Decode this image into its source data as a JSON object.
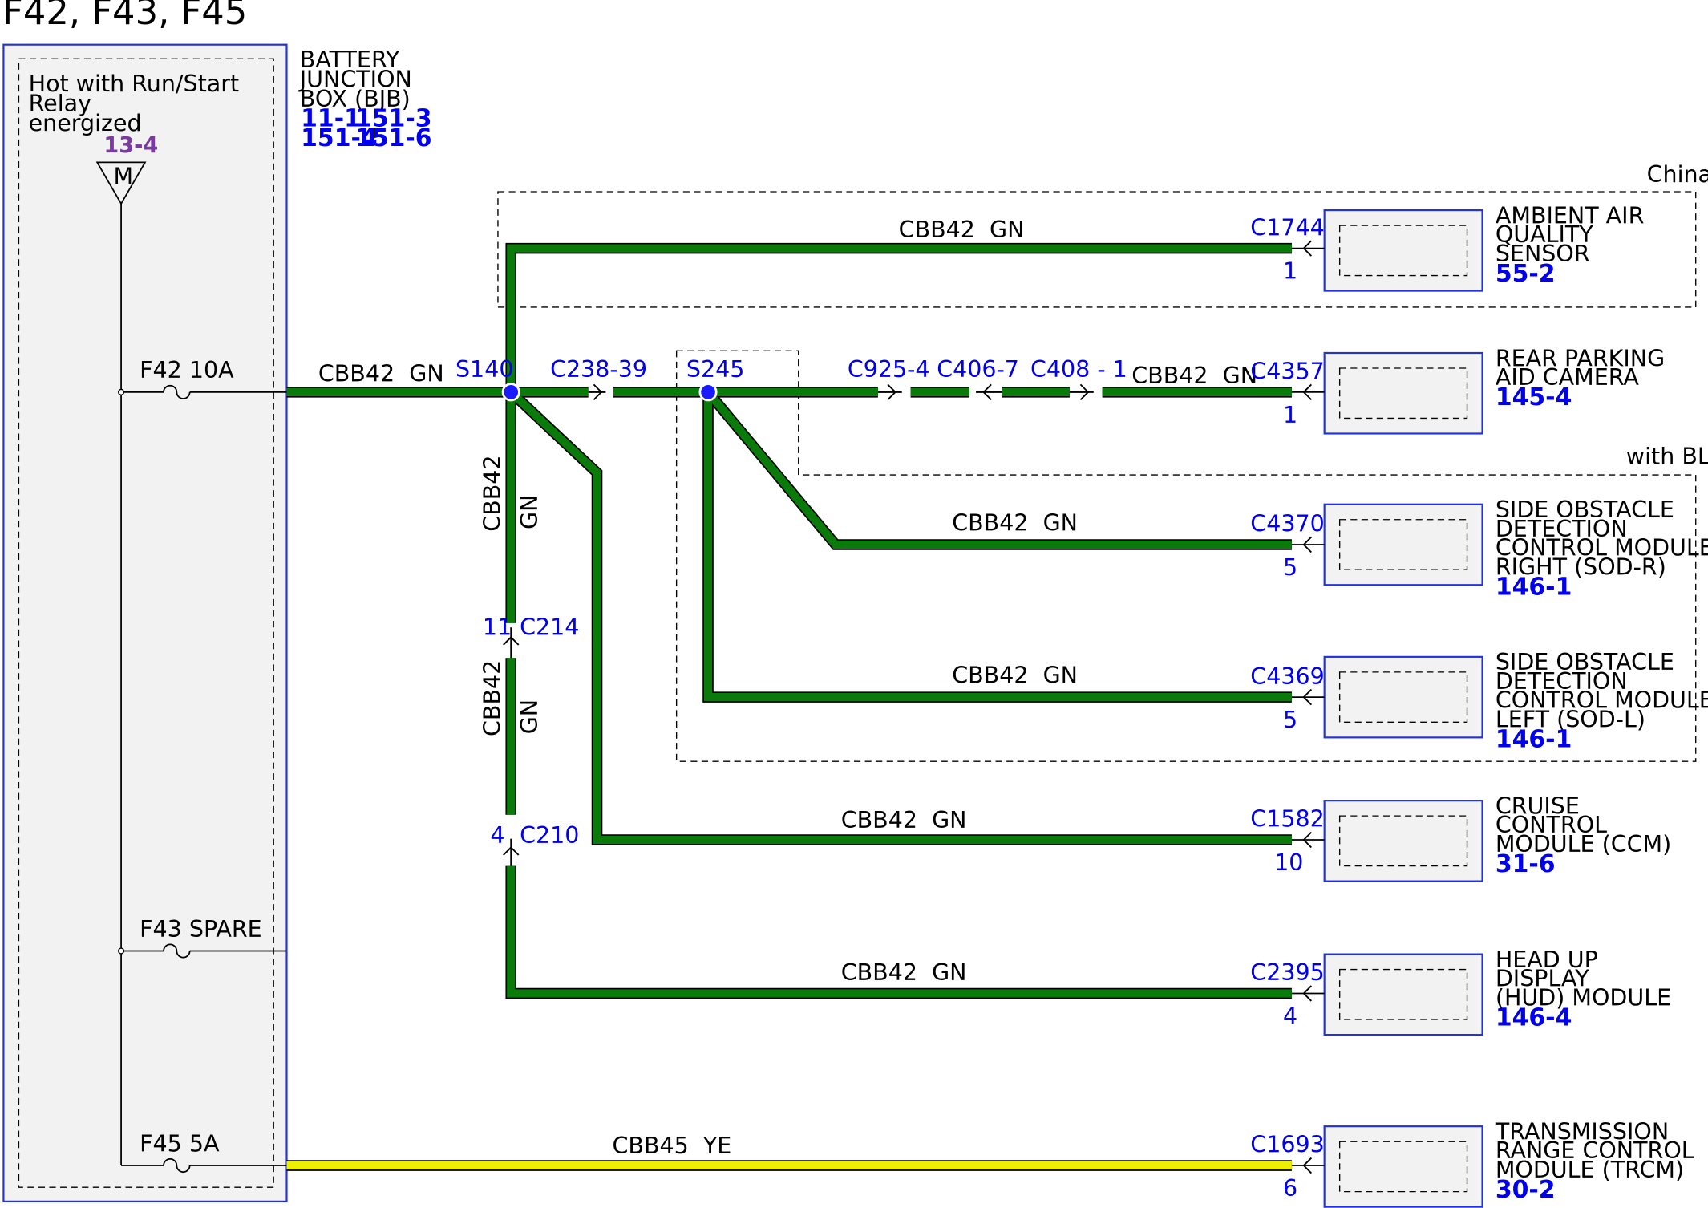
{
  "title": "F42, F43, F45",
  "colors": {
    "wire_gn": "#0a7a0a",
    "wire_ye": "#eeee00",
    "wire_outline": "#000000",
    "connector_text": "#0000ee",
    "ref_purple": "#7a3aa0",
    "box_fill": "#f2f2f2",
    "splice": "#1a1aff"
  },
  "bjb": {
    "label_lines": [
      "BATTERY",
      "JUNCTION",
      "BOX (BJB)"
    ],
    "refs": [
      "11-1",
      "151-3",
      "151-4",
      "151-6"
    ],
    "hot_lines": [
      "Hot with Run/Start",
      "Relay",
      "energized"
    ],
    "relay_ref": "13-4",
    "relay_symbol": "M",
    "fuses": [
      {
        "id": "F42",
        "label": "F42  10A"
      },
      {
        "id": "F43",
        "label": "F43  SPARE"
      },
      {
        "id": "F45",
        "label": "F45  5A"
      }
    ]
  },
  "regions": {
    "china": "China",
    "blis": "with BLIS"
  },
  "splices": {
    "s140": "S140",
    "s245": "S245"
  },
  "inline_connectors": {
    "c238": "C238-39",
    "c925": "C925-4",
    "c406": "C406-7",
    "c408": "C408 - 1",
    "c214": {
      "name": "C214",
      "pin": "11"
    },
    "c210": {
      "name": "C210",
      "pin": "4"
    }
  },
  "wires": {
    "bjb_out": "CBB42  GN",
    "vertical_a_1": "CBB42",
    "vertical_a_2": "GN",
    "vertical_b_1": "CBB42",
    "vertical_b_2": "GN",
    "aaq": "CBB42  GN",
    "camera": "CBB42  GN",
    "sod_r": "CBB42  GN",
    "sod_l": "CBB42  GN",
    "ccm": "CBB42  GN",
    "hud": "CBB42  GN",
    "trcm": "CBB45  YE"
  },
  "components": [
    {
      "key": "aaq",
      "connector": "C1744",
      "pin": "1",
      "lines": [
        "AMBIENT AIR",
        "QUALITY",
        "SENSOR"
      ],
      "ref": "55-2"
    },
    {
      "key": "camera",
      "connector": "C4357",
      "pin": "1",
      "lines": [
        "REAR PARKING",
        "AID CAMERA"
      ],
      "ref": "145-4"
    },
    {
      "key": "sod_r",
      "connector": "C4370",
      "pin": "5",
      "lines": [
        "SIDE OBSTACLE",
        "DETECTION",
        "CONTROL MODULE-",
        "RIGHT (SOD-R)"
      ],
      "ref": "146-1"
    },
    {
      "key": "sod_l",
      "connector": "C4369",
      "pin": "5",
      "lines": [
        "SIDE OBSTACLE",
        "DETECTION",
        "CONTROL MODULE-",
        "LEFT (SOD-L)"
      ],
      "ref": "146-1"
    },
    {
      "key": "ccm",
      "connector": "C1582",
      "pin": "10",
      "lines": [
        "CRUISE",
        "CONTROL",
        "MODULE (CCM)"
      ],
      "ref": "31-6"
    },
    {
      "key": "hud",
      "connector": "C2395",
      "pin": "4",
      "lines": [
        "HEAD UP",
        "DISPLAY",
        "(HUD) MODULE"
      ],
      "ref": "146-4"
    },
    {
      "key": "trcm",
      "connector": "C1693",
      "pin": "6",
      "lines": [
        "TRANSMISSION",
        "RANGE CONTROL",
        "MODULE (TRCM)"
      ],
      "ref": "30-2"
    }
  ]
}
